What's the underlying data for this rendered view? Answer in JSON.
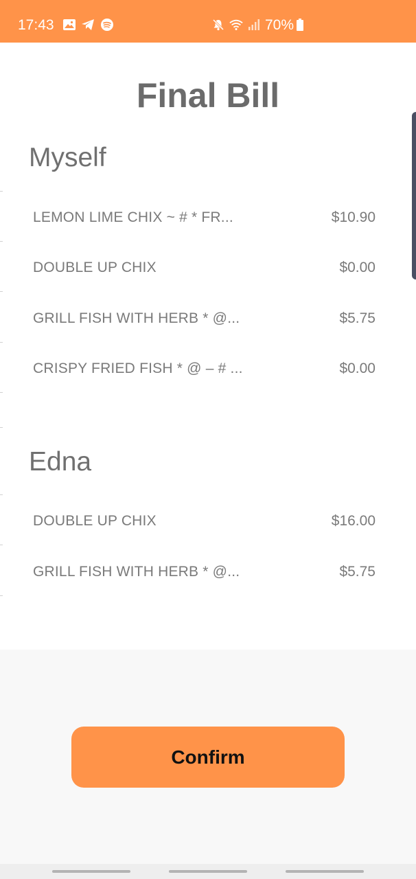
{
  "status_bar": {
    "time": "17:43",
    "battery": "70%",
    "icons": [
      "gallery-icon",
      "telegram-icon",
      "spotify-icon",
      "mute-icon",
      "wifi-icon",
      "signal-icon",
      "battery-icon"
    ]
  },
  "page": {
    "title": "Final Bill"
  },
  "sections": [
    {
      "name": "Myself",
      "items": [
        {
          "name": "LEMON LIME CHIX ~ # * FR...",
          "price": "$10.90"
        },
        {
          "name": "DOUBLE UP CHIX",
          "price": "$0.00"
        },
        {
          "name": "GRILL FISH WITH HERB * @...",
          "price": "$5.75"
        },
        {
          "name": "CRISPY FRIED FISH * @ – # ...",
          "price": "$0.00"
        }
      ]
    },
    {
      "name": "Edna",
      "items": [
        {
          "name": "DOUBLE UP CHIX",
          "price": "$16.00"
        },
        {
          "name": "GRILL FISH WITH HERB * @...",
          "price": "$5.75"
        }
      ]
    }
  ],
  "footer": {
    "confirm_label": "Confirm"
  },
  "colors": {
    "accent": "#ff9349",
    "text_gray": "#7a7a7a",
    "title_gray": "#6b6b6b",
    "footer_bg": "#f8f8f8"
  }
}
